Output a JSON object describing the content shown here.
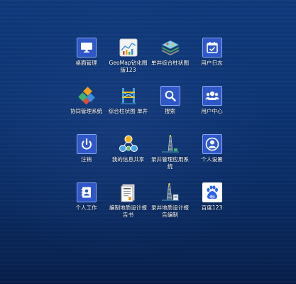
{
  "desktop": {
    "apps": [
      {
        "label": "桌面管理",
        "icon": "monitor-icon"
      },
      {
        "label": "GeoMap钻化图版123",
        "icon": "geomap-chart-icon"
      },
      {
        "label": "单井综合柱状图",
        "icon": "layers-map-icon"
      },
      {
        "label": "用户日志",
        "icon": "calendar-check-icon"
      },
      {
        "label": "协同管理系统",
        "icon": "collaboration-blocks-icon"
      },
      {
        "label": "综合柱状图 单井",
        "icon": "column-tower-icon"
      },
      {
        "label": "搜索",
        "icon": "search-icon"
      },
      {
        "label": "用户中心",
        "icon": "users-icon"
      },
      {
        "label": "注销",
        "icon": "power-icon"
      },
      {
        "label": "我的信息共享",
        "icon": "share-network-icon"
      },
      {
        "label": "录井管理应用系统",
        "icon": "drilling-rig-icon"
      },
      {
        "label": "个人设置",
        "icon": "user-circle-icon"
      },
      {
        "label": "个人工作",
        "icon": "contact-card-icon"
      },
      {
        "label": "编制地质设计报告书",
        "icon": "document-report-icon"
      },
      {
        "label": "录井地质设计报告编制",
        "icon": "drilling-rig-report-icon"
      },
      {
        "label": "百度123",
        "icon": "baidu-icon"
      }
    ]
  },
  "colors": {
    "tile": "#2f57c8",
    "tile_border": "#8aa6ee",
    "background_top": "#0f3a7c",
    "background_bottom": "#081f4b"
  }
}
